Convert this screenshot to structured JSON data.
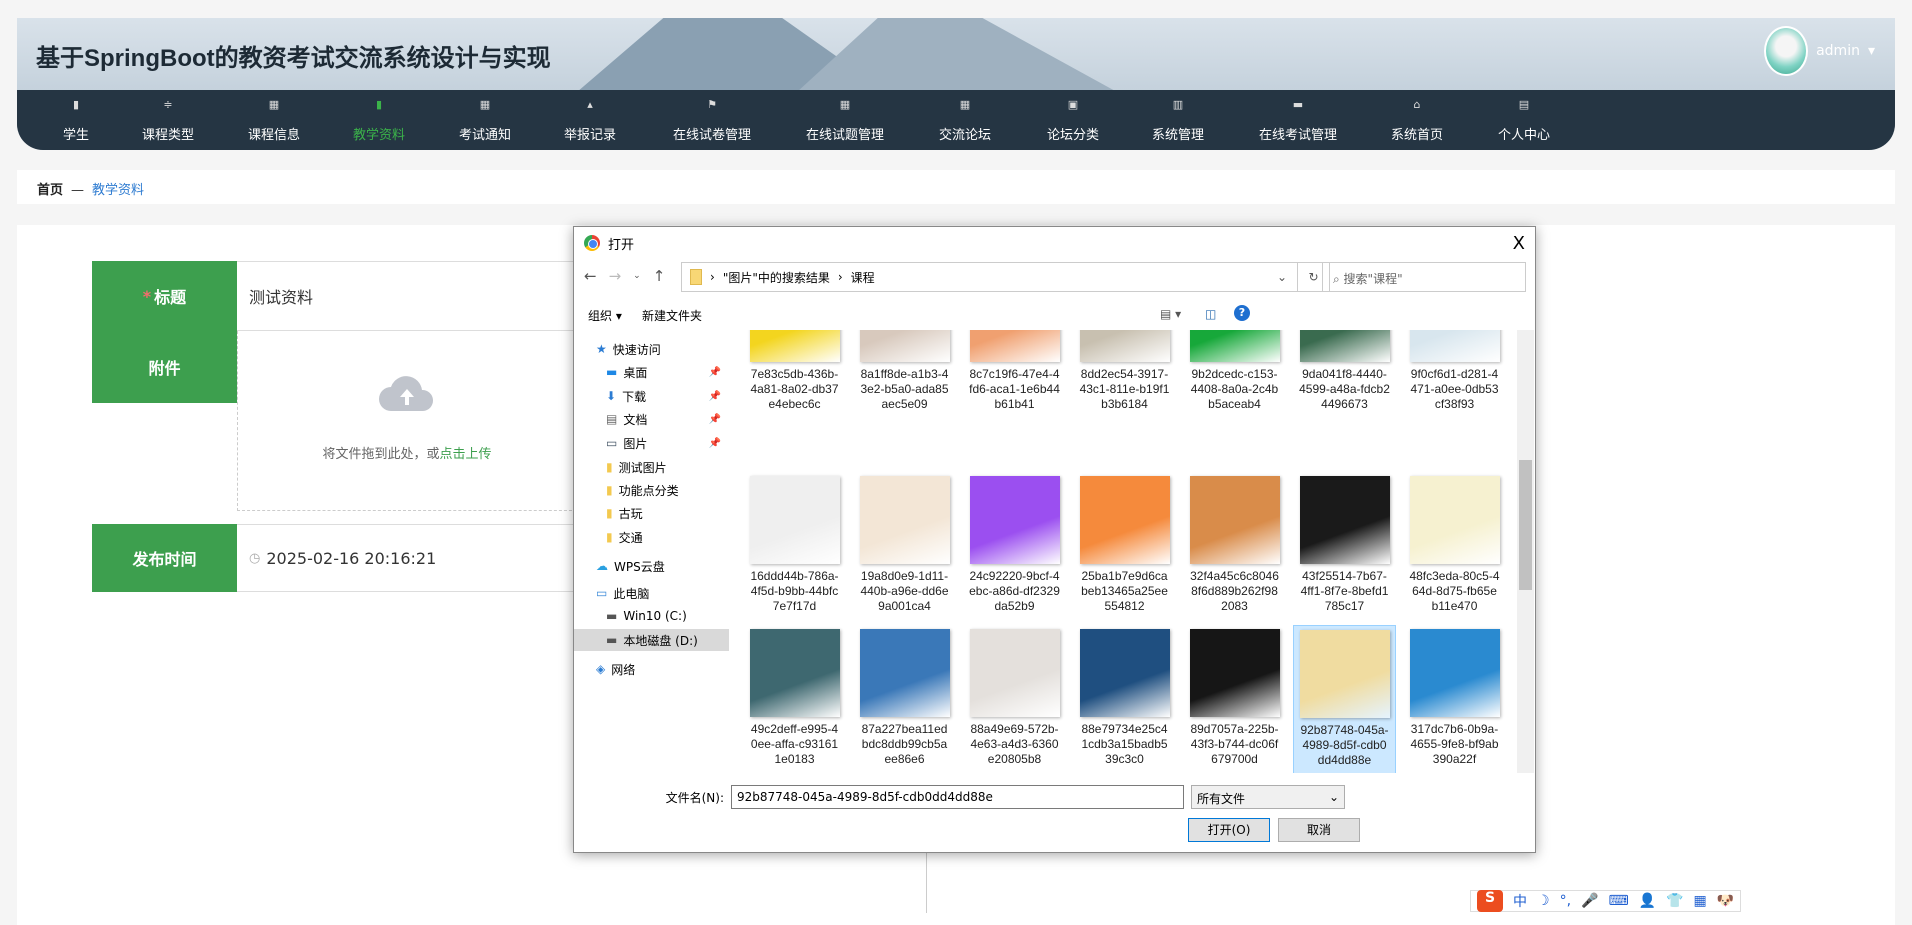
{
  "site": {
    "title": "基于SpringBoot的教资考试交流系统设计与实现",
    "user": "admin"
  },
  "nav": [
    {
      "label": "学生",
      "icon": "▮"
    },
    {
      "label": "课程类型",
      "icon": "≑"
    },
    {
      "label": "课程信息",
      "icon": "▦"
    },
    {
      "label": "教学资料",
      "icon": "▮",
      "active": true
    },
    {
      "label": "考试通知",
      "icon": "▦"
    },
    {
      "label": "举报记录",
      "icon": "▴"
    },
    {
      "label": "在线试卷管理",
      "icon": "⚑"
    },
    {
      "label": "在线试题管理",
      "icon": "▦"
    },
    {
      "label": "交流论坛",
      "icon": "▦"
    },
    {
      "label": "论坛分类",
      "icon": "▣"
    },
    {
      "label": "系统管理",
      "icon": "▥"
    },
    {
      "label": "在线考试管理",
      "icon": "▬"
    },
    {
      "label": "系统首页",
      "icon": "⌂"
    },
    {
      "label": "个人中心",
      "icon": "▤"
    }
  ],
  "breadcrumb": {
    "home": "首页",
    "sep": "—",
    "current": "教学资料"
  },
  "form": {
    "title_label": "标题",
    "title_required": "*",
    "title_value": "测试资料",
    "attach_label": "附件",
    "upload_hint": "将文件拖到此处，或",
    "upload_link": "点击上传",
    "time_label": "发布时间",
    "time_value": "2025-02-16 20:16:21"
  },
  "dialog": {
    "title": "打开",
    "close": "X",
    "path": [
      "\"图片\"中的搜索结果",
      "课程"
    ],
    "search_placeholder": "搜索\"课程\"",
    "organize": "组织 ▾",
    "new_folder": "新建文件夹",
    "help": "?",
    "sidebar": [
      {
        "label": "快速访问",
        "icon": "star-icon"
      },
      {
        "label": "桌面",
        "icon": "desktop-icon",
        "pinned": true
      },
      {
        "label": "下载",
        "icon": "download-icon",
        "pinned": true
      },
      {
        "label": "文档",
        "icon": "document-icon",
        "pinned": true
      },
      {
        "label": "图片",
        "icon": "pictures-icon",
        "pinned": true
      },
      {
        "label": "测试图片",
        "icon": "folder-icon"
      },
      {
        "label": "功能点分类",
        "icon": "folder-icon"
      },
      {
        "label": "古玩",
        "icon": "folder-icon"
      },
      {
        "label": "交通",
        "icon": "folder-icon"
      },
      {
        "label": "WPS云盘",
        "icon": "cloud-icon"
      },
      {
        "label": "此电脑",
        "icon": "computer-icon"
      },
      {
        "label": "Win10 (C:)",
        "icon": "drive-icon"
      },
      {
        "label": "本地磁盘 (D:)",
        "icon": "drive-icon",
        "selected": true
      },
      {
        "label": "网络",
        "icon": "network-icon"
      }
    ],
    "files": [
      {
        "name": "7e83c5db-436b-4a81-8a02-db37e4ebec6c",
        "color": "#f3d51f"
      },
      {
        "name": "8a1ff8de-a1b3-43e2-b5a0-ada85aec5e09",
        "color": "#d8c9bd"
      },
      {
        "name": "8c7c19f6-47e4-4fd6-aca1-1e6b44b61b41",
        "color": "#f0a070"
      },
      {
        "name": "8dd2ec54-3917-43c1-811e-b19f1b3b6184",
        "color": "#c8c0b0"
      },
      {
        "name": "9b2dcedc-c153-4408-8a0a-2c4bb5aceab4",
        "color": "#17a83a"
      },
      {
        "name": "9da041f8-4440-4599-a48a-fdcb24496673",
        "color": "#3a6b4f"
      },
      {
        "name": "9f0cf6d1-d281-4471-a0ee-0db53cf38f93",
        "color": "#d8e6ee"
      },
      {
        "name": "16ddd44b-786a-4f5d-b9bb-44bfc7e7f17d",
        "color": "#efefef"
      },
      {
        "name": "19a8d0e9-1d11-440b-a96e-dd6e9a001ca4",
        "color": "#f3e6d6"
      },
      {
        "name": "24c92220-9bcf-4ebc-a86d-df2329da52b9",
        "color": "#9b4ff0"
      },
      {
        "name": "25ba1b7e9d6cabeb13465a25ee554812",
        "color": "#f58a3c"
      },
      {
        "name": "32f4a45c6c80468f6d889b262f982083",
        "color": "#d98c4a"
      },
      {
        "name": "43f25514-7b67-4ff1-8f7e-8befd1785c17",
        "color": "#1a1a1a"
      },
      {
        "name": "48fc3eda-80c5-464d-8d75-fb65eb11e470",
        "color": "#f6f1d0"
      },
      {
        "name": "49c2deff-e995-40ee-affa-c931611e0183",
        "color": "#3e6870"
      },
      {
        "name": "87a227bea11edbdc8ddb99cb5aee86e6",
        "color": "#3a78b8"
      },
      {
        "name": "88a49e69-572b-4e63-a4d3-6360e20805b8",
        "color": "#e4e0dc"
      },
      {
        "name": "88e79734e25c41cdb3a15badb539c3c0",
        "color": "#1f4f80"
      },
      {
        "name": "89d7057a-225b-43f3-b744-dc06f679700d",
        "color": "#161616"
      },
      {
        "name": "92b87748-045a-4989-8d5f-cdb0dd4dd88e",
        "color": "#f0dca0",
        "selected": true
      },
      {
        "name": "317dc7b6-0b9a-4655-9fe8-bf9ab390a22f",
        "color": "#2a8ad0"
      }
    ],
    "filename_label": "文件名(N):",
    "filename_value": "92b87748-045a-4989-8d5f-cdb0dd4dd88e",
    "filetype": "所有文件",
    "open": "打开(O)",
    "cancel": "取消"
  },
  "ime": {
    "logo": "S",
    "items": [
      "中",
      "☽",
      "°,",
      "🎤",
      "⌨",
      "👤",
      "👕",
      "▦",
      "🐶"
    ]
  }
}
